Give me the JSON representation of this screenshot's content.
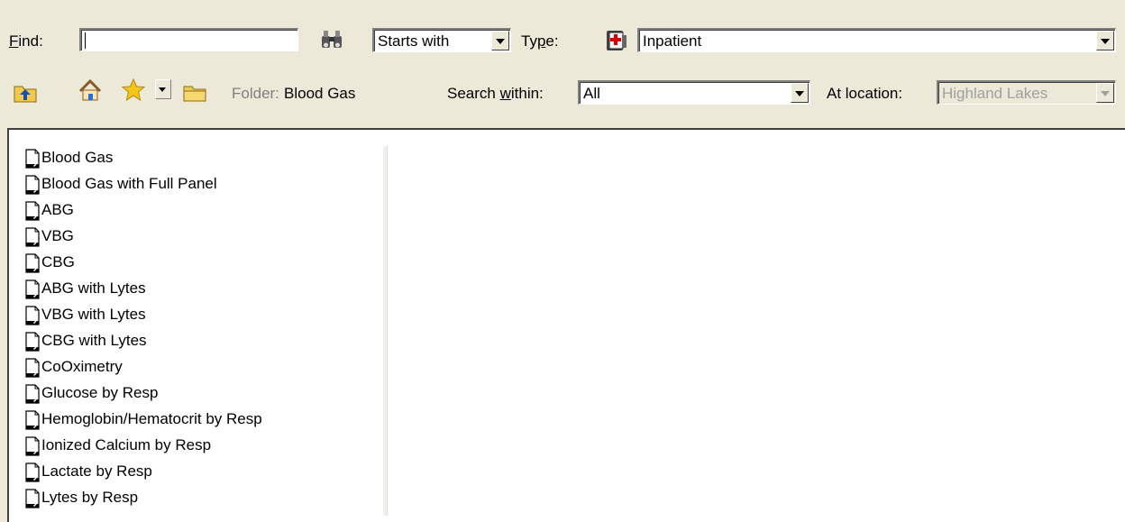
{
  "find": {
    "label_prefix": "",
    "label_accel": "F",
    "label_rest": "ind:",
    "value": ""
  },
  "match_mode": {
    "selected": "Starts with"
  },
  "type": {
    "label_prefix": "Ty",
    "label_accel": "p",
    "label_rest": "e:",
    "selected": "Inpatient"
  },
  "folder": {
    "label": "Folder:",
    "name": "Blood Gas"
  },
  "search_within": {
    "label_prefix": "Search ",
    "label_accel": "w",
    "label_rest": "ithin:",
    "selected": "All"
  },
  "at_location": {
    "label": "At location:",
    "selected": "Highland Lakes"
  },
  "icons": {
    "find_button": "binoculars-icon",
    "type_icon": "patient-chart-icon",
    "up_folder": "up-folder-icon",
    "home": "home-icon",
    "favorites": "star-icon",
    "folder": "folder-icon",
    "item": "document-icon"
  },
  "items": [
    "Blood Gas",
    "Blood Gas with Full Panel",
    "ABG",
    "VBG",
    "CBG",
    "ABG with Lytes",
    "VBG with Lytes",
    "CBG with Lytes",
    "CoOximetry",
    "Glucose by Resp",
    "Hemoglobin/Hematocrit by Resp",
    "Ionized Calcium by Resp",
    "Lactate by Resp",
    "Lytes by Resp"
  ]
}
